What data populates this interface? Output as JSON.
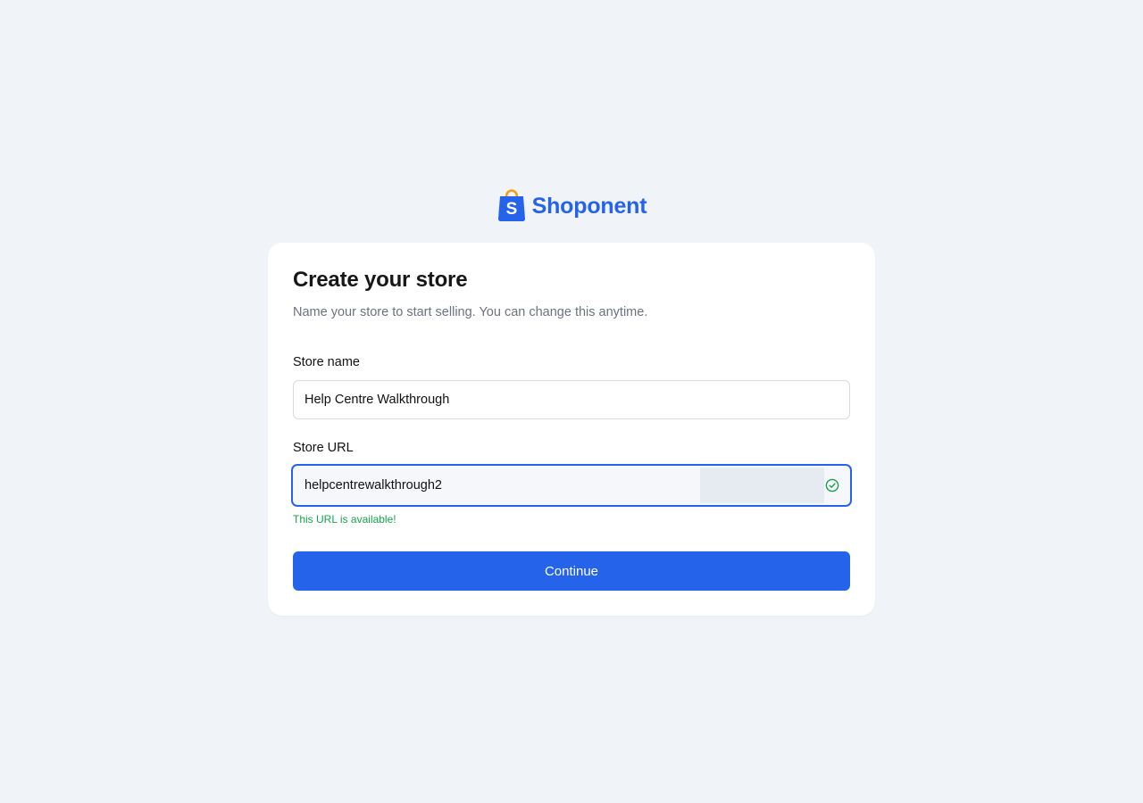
{
  "brand": {
    "name": "Shoponent",
    "logo_icon": "shopping-bag-icon",
    "logo_letter": "S"
  },
  "form": {
    "title": "Create your store",
    "subtitle": "Name your store to start selling. You can change this anytime.",
    "store_name": {
      "label": "Store name",
      "value": "Help Centre Walkthrough"
    },
    "store_url": {
      "label": "Store URL",
      "value": "helpcentrewalkthrough2",
      "status_icon": "check-circle-icon",
      "helper": "This URL is available!"
    },
    "continue_label": "Continue"
  },
  "colors": {
    "background": "#f0f3f8",
    "accent": "#2563eb",
    "success": "#16a34a",
    "logo_handle": "#f59e0b"
  }
}
